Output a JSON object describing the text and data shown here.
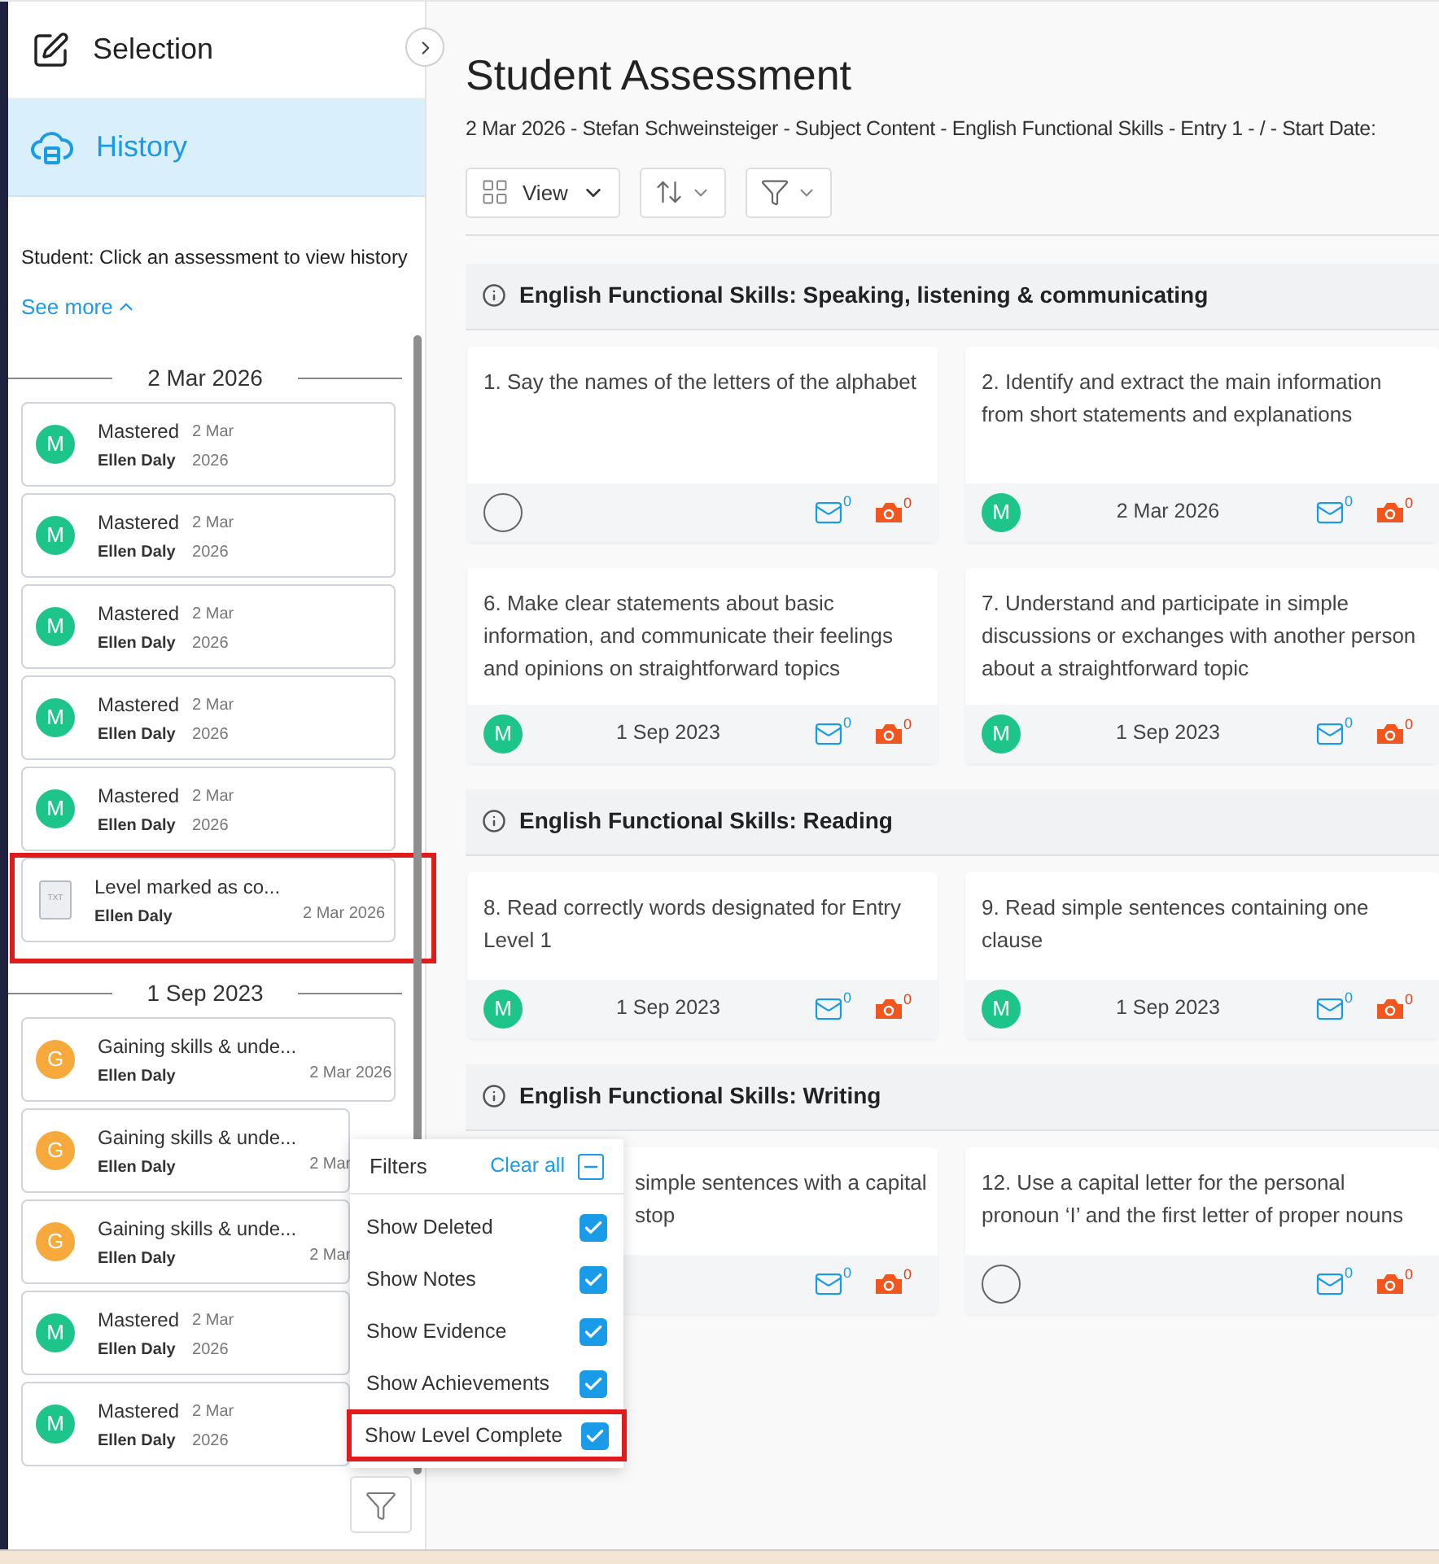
{
  "sidebar": {
    "tabs": [
      {
        "label": "Selection",
        "kind": "edit",
        "selected": false
      },
      {
        "label": "History",
        "kind": "cloud",
        "selected": true
      }
    ],
    "info": "Student: Click an assessment to view history",
    "see_more": "See more",
    "groups": [
      {
        "date": "2 Mar 2026",
        "items": [
          {
            "kind": "avatar",
            "letter": "M",
            "color": "#1ec58a",
            "title": "Mastered",
            "by": "Ellen Daly",
            "date": "2 Mar 2026",
            "wrap": true,
            "highlighted": false
          },
          {
            "kind": "avatar",
            "letter": "M",
            "color": "#1ec58a",
            "title": "Mastered",
            "by": "Ellen Daly",
            "date": "2 Mar 2026",
            "wrap": true,
            "highlighted": false
          },
          {
            "kind": "avatar",
            "letter": "M",
            "color": "#1ec58a",
            "title": "Mastered",
            "by": "Ellen Daly",
            "date": "2 Mar 2026",
            "wrap": true,
            "highlighted": false
          },
          {
            "kind": "avatar",
            "letter": "M",
            "color": "#1ec58a",
            "title": "Mastered",
            "by": "Ellen Daly",
            "date": "2 Mar 2026",
            "wrap": true,
            "highlighted": false
          },
          {
            "kind": "avatar",
            "letter": "M",
            "color": "#1ec58a",
            "title": "Mastered",
            "by": "Ellen Daly",
            "date": "2 Mar 2026",
            "wrap": true,
            "highlighted": false
          },
          {
            "kind": "file",
            "file_label": "TXT",
            "title": "Level marked as co...",
            "by": "Ellen Daly",
            "date": "2 Mar 2026",
            "wrap": false,
            "highlighted": true
          }
        ]
      },
      {
        "date": "1 Sep 2023",
        "items": [
          {
            "kind": "avatar",
            "letter": "G",
            "color": "#f7a93b",
            "title": "Gaining skills & unde...",
            "by": "Ellen Daly",
            "date": "2 Mar 2026",
            "wrap": false,
            "highlighted": false
          },
          {
            "kind": "avatar",
            "letter": "G",
            "color": "#f7a93b",
            "title": "Gaining skills & unde...",
            "by": "Ellen Daly",
            "date": "2 Mar",
            "wrap": false,
            "highlighted": false
          },
          {
            "kind": "avatar",
            "letter": "G",
            "color": "#f7a93b",
            "title": "Gaining skills & unde...",
            "by": "Ellen Daly",
            "date": "2 Mar",
            "wrap": false,
            "highlighted": false
          },
          {
            "kind": "avatar",
            "letter": "M",
            "color": "#1ec58a",
            "title": "Mastered",
            "by": "Ellen Daly",
            "date": "2 Mar 2026",
            "wrap": true,
            "highlighted": false
          },
          {
            "kind": "avatar",
            "letter": "M",
            "color": "#1ec58a",
            "title": "Mastered",
            "by": "Ellen Daly",
            "date": "2 Mar 2026",
            "wrap": true,
            "highlighted": false
          }
        ]
      }
    ]
  },
  "filters": {
    "title": "Filters",
    "clear_all": "Clear all",
    "indeterminate": true,
    "items": [
      {
        "label": "Show Deleted",
        "checked": true,
        "highlighted": false
      },
      {
        "label": "Show Notes",
        "checked": true,
        "highlighted": false
      },
      {
        "label": "Show Evidence",
        "checked": true,
        "highlighted": false
      },
      {
        "label": "Show Achievements",
        "checked": true,
        "highlighted": false
      },
      {
        "label": "Show Level Complete",
        "checked": true,
        "highlighted": true
      }
    ]
  },
  "main": {
    "title": "Student Assessment",
    "subtitle": "2 Mar 2026 - Stefan Schweinsteiger - Subject Content - English Functional Skills - Entry 1 - / - Start Date:",
    "view_button": "View",
    "sections": [
      {
        "title": "English Functional Skills: Speaking, listening & communicating",
        "cards": [
          {
            "lines": [
              "1. Say the names of the letters of the alphabet"
            ],
            "assessed": false,
            "messages": "0",
            "evidence": "0"
          },
          {
            "lines": [
              "2. Identify and extract the main information from short statements and explanations"
            ],
            "status": "M",
            "date": "2 Mar 2026",
            "messages": "0",
            "evidence": "0"
          },
          {
            "lines": [
              "6. Make clear statements about basic information, and communicate their feelings and opinions on straightforward topics"
            ],
            "status": "M",
            "date": "1 Sep 2023",
            "messages": "0",
            "evidence": "0"
          },
          {
            "lines": [
              "7. Understand and participate in simple discussions or exchanges with another person about a straightforward topic"
            ],
            "status": "M",
            "date": "1 Sep 2023",
            "messages": "0",
            "evidence": "0"
          }
        ]
      },
      {
        "title": "English Functional Skills: Reading",
        "cards": [
          {
            "lines": [
              "8. Read correctly words designated for Entry Level 1"
            ],
            "status": "M",
            "date": "1 Sep 2023",
            "messages": "0",
            "evidence": "0"
          },
          {
            "lines": [
              "9. Read simple sentences containing one clause"
            ],
            "status": "M",
            "date": "1 Sep 2023",
            "messages": "0",
            "evidence": "0"
          }
        ]
      },
      {
        "title": "English Functional Skills: Writing",
        "cards": [
          {
            "lines": [
              "simple sentences with a capital",
              "stop"
            ],
            "covered": true,
            "messages": "0",
            "evidence": "0"
          },
          {
            "lines": [
              "12. Use a capital letter for the personal pronoun ‘I’ and the first letter of proper nouns"
            ],
            "assessed": false,
            "messages": "0",
            "evidence": "0"
          }
        ]
      }
    ]
  }
}
